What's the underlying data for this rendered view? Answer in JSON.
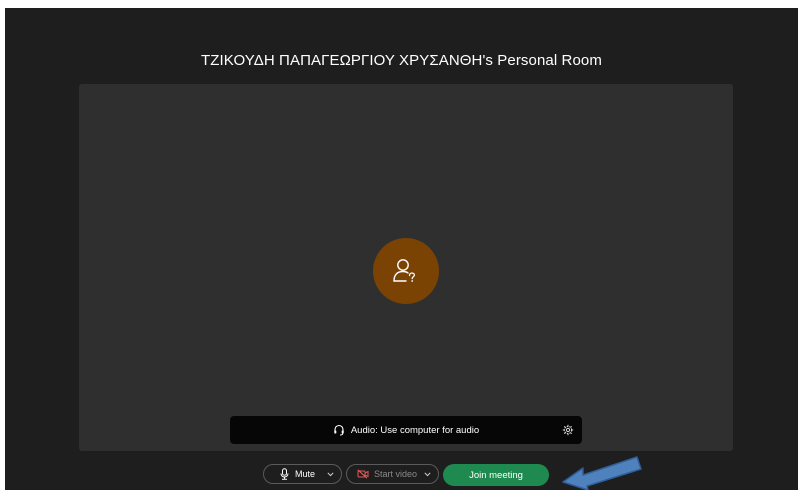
{
  "window": {
    "room_title": "ΤΖΙΚΟΥΔΗ ΠΑΠΑΓΕΩΡΓΙΟΥ ΧΡΥΣΑΝΘΗ's Personal Room"
  },
  "preview": {
    "avatar_icon": "unknown-user-icon",
    "avatar_color": "#7a4304"
  },
  "audio": {
    "label": "Audio: Use computer for audio",
    "headset_icon": "headset-icon",
    "settings_icon": "gear-icon"
  },
  "controls": {
    "mute_label": "Mute",
    "start_video_label": "Start video",
    "join_label": "Join meeting",
    "join_color": "#1f8a4f"
  },
  "annotation": {
    "arrow_color": "#4f81bd"
  }
}
